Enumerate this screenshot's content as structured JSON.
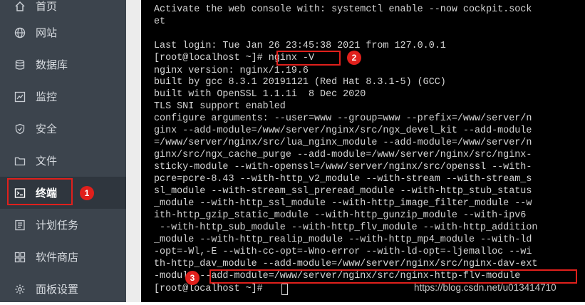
{
  "sidebar": {
    "items": [
      {
        "label": "首页",
        "icon": "home-icon"
      },
      {
        "label": "网站",
        "icon": "globe-icon"
      },
      {
        "label": "数据库",
        "icon": "database-icon"
      },
      {
        "label": "监控",
        "icon": "monitor-icon"
      },
      {
        "label": "安全",
        "icon": "shield-icon"
      },
      {
        "label": "文件",
        "icon": "folder-icon"
      },
      {
        "label": "终端",
        "icon": "terminal-icon",
        "active": true
      },
      {
        "label": "计划任务",
        "icon": "task-list-icon"
      },
      {
        "label": "软件商店",
        "icon": "app-store-icon"
      },
      {
        "label": "面板设置",
        "icon": "gear-icon"
      }
    ]
  },
  "badges": [
    "1",
    "2",
    "3"
  ],
  "terminal": {
    "lines": [
      "Activate the web console with: systemctl enable --now cockpit.sock",
      "et",
      "",
      "Last login: Tue Jan 26 23:45:38 2021 from 127.0.0.1",
      "[root@localhost ~]# nginx -V",
      "nginx version: nginx/1.19.6",
      "built by gcc 8.3.1 20191121 (Red Hat 8.3.1-5) (GCC)",
      "built with OpenSSL 1.1.1i  8 Dec 2020",
      "TLS SNI support enabled",
      "configure arguments: --user=www --group=www --prefix=/www/server/n",
      "ginx --add-module=/www/server/nginx/src/ngx_devel_kit --add-module",
      "=/www/server/nginx/src/lua_nginx_module --add-module=/www/server/n",
      "ginx/src/ngx_cache_purge --add-module=/www/server/nginx/src/nginx-",
      "sticky-module --with-openssl=/www/server/nginx/src/openssl --with-",
      "pcre=pcre-8.43 --with-http_v2_module --with-stream --with-stream_s",
      "sl_module --with-stream_ssl_preread_module --with-http_stub_status",
      "_module --with-http_ssl_module --with-http_image_filter_module --w",
      "ith-http_gzip_static_module --with-http_gunzip_module --with-ipv6",
      " --with-http_sub_module --with-http_flv_module --with-http_addition",
      "_module --with-http_realip_module --with-http_mp4_module --with-ld",
      "-opt=-Wl,-E --with-cc-opt=-Wno-error --with-ld-opt=-ljemalloc --wi",
      "th-http_dav_module --add-module=/www/server/nginx/src/nginx-dav-ext",
      "-module --add-module=/www/server/nginx/src/nginx-http-flv-module",
      "[root@localhost ~]# "
    ]
  },
  "watermark": "https://blog.csdn.net/u013414710",
  "colors": {
    "accent": "#e0201c",
    "sidebar_bg": "#3c444d",
    "terminal_bg": "#000000",
    "terminal_text": "#d6d6d6"
  }
}
